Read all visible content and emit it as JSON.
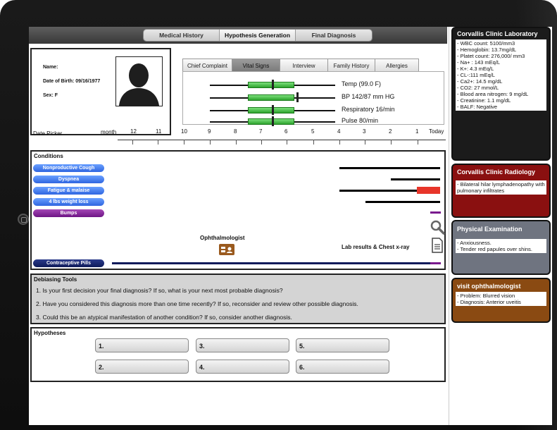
{
  "nav": {
    "tabs": [
      "Medical History",
      "Hypothesis Generation",
      "Final Diagnosis"
    ],
    "active_index": 1
  },
  "patient": {
    "name_label": "Name:",
    "dob": "Date of Birth: 09/16/1977",
    "sex": "Sex: F"
  },
  "vitals_tabs": [
    "Chief Complaint",
    "Vital Signs",
    "Interview",
    "Family History",
    "Allergies"
  ],
  "vitals_active_index": 1,
  "vitals": [
    "Temp (99.0 F)",
    "BP 142/87 mm HG",
    "Respiratory 16/min",
    "Pulse 80/min"
  ],
  "date_picker": {
    "label": "Date Picker",
    "unit": "month",
    "ticks": [
      "12",
      "11",
      "10",
      "9",
      "8",
      "7",
      "6",
      "5",
      "4",
      "3",
      "2",
      "1",
      "Today"
    ]
  },
  "conditions": {
    "title": "Conditions",
    "items": [
      "Nonproductive Cough",
      "Dyspnea",
      "Fatigue & malaise",
      "4 lbs weight loss",
      "Bumps"
    ],
    "medication": "Contraceptive Pills",
    "ophthalmologist": "Ophthalmologist",
    "lab_results": "Lab results & Chest x-ray"
  },
  "debiasing": {
    "title": "Debiasing Tools",
    "questions": [
      "1. Is your first decision your final diagnosis? If so, what is your next most probable diagnosis?",
      "2. Have you considered this diagnosis more than one time recently? If so, reconsider and review other possible diagnosis.",
      "3. Could this be an atypical manifestation of another condition? If so, consider another diagnosis."
    ]
  },
  "hypotheses": {
    "title": "Hypotheses",
    "slots": [
      "1.",
      "3.",
      "5.",
      "2.",
      "4.",
      "6."
    ]
  },
  "cards": [
    {
      "title": "Corvallis Clinic Laboratory",
      "color": "#1b1b1b",
      "lines": [
        "- WBC count: 5100/mm3",
        "- Hemoglobin: 13.7mg/dL",
        "- Platet count: 276,000/ mm3",
        "- Na+ : 143 mEq/L",
        "- K+: 4.3 mEq/L",
        "- CL-:111 mEq/L",
        "- Ca2+: 14.5 mg/dL",
        "- CO2: 27 mmol/L",
        "- Blood area nitrogen: 9 mg/dL",
        "- Creatinine: 1.1 mg/dL",
        "- BALF: Negative"
      ]
    },
    {
      "title": "Corvallis Clinic Radiology",
      "color": "#8a1010",
      "lines": [
        "- Bilateral hilar lymphadenopathy with pulmonary infiltrates"
      ]
    },
    {
      "title": "Physical Examination",
      "color": "#6f7480",
      "lines": [
        "- Anxiousness.",
        "- Tender red papules over shins."
      ]
    },
    {
      "title": "visit ophthalmologist",
      "color": "#8a4a12",
      "lines": [
        "- Problem: Blurred vision",
        "- Diagnosis: Anterior uveitis"
      ]
    }
  ]
}
